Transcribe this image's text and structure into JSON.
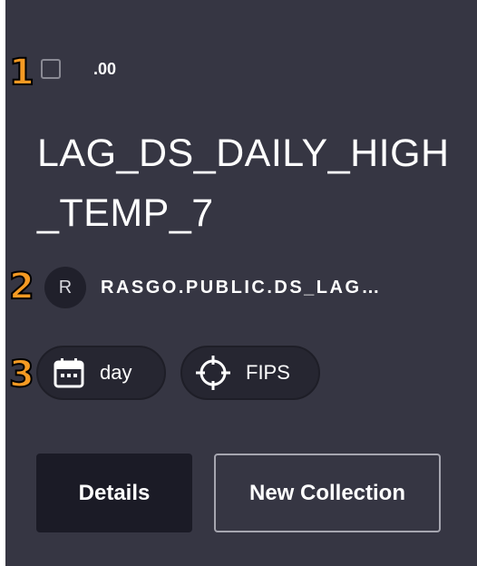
{
  "markers": [
    "1",
    "2",
    "3"
  ],
  "card": {
    "selected": false,
    "value": ".00",
    "title": "LAG_DS_DAILY_HIGH_TEMP_7",
    "owner_initial": "R",
    "source": "RASGO.PUBLIC.DS_LAG…",
    "tags": [
      {
        "label": "day",
        "icon": "calendar-icon"
      },
      {
        "label": "FIPS",
        "icon": "crosshair-icon"
      }
    ],
    "actions": {
      "details_label": "Details",
      "new_collection_label": "New Collection"
    }
  },
  "colors": {
    "card_background": "#363643",
    "chip_background": "#262631",
    "button_background": "#1b1b26",
    "marker": "#f59a23"
  }
}
